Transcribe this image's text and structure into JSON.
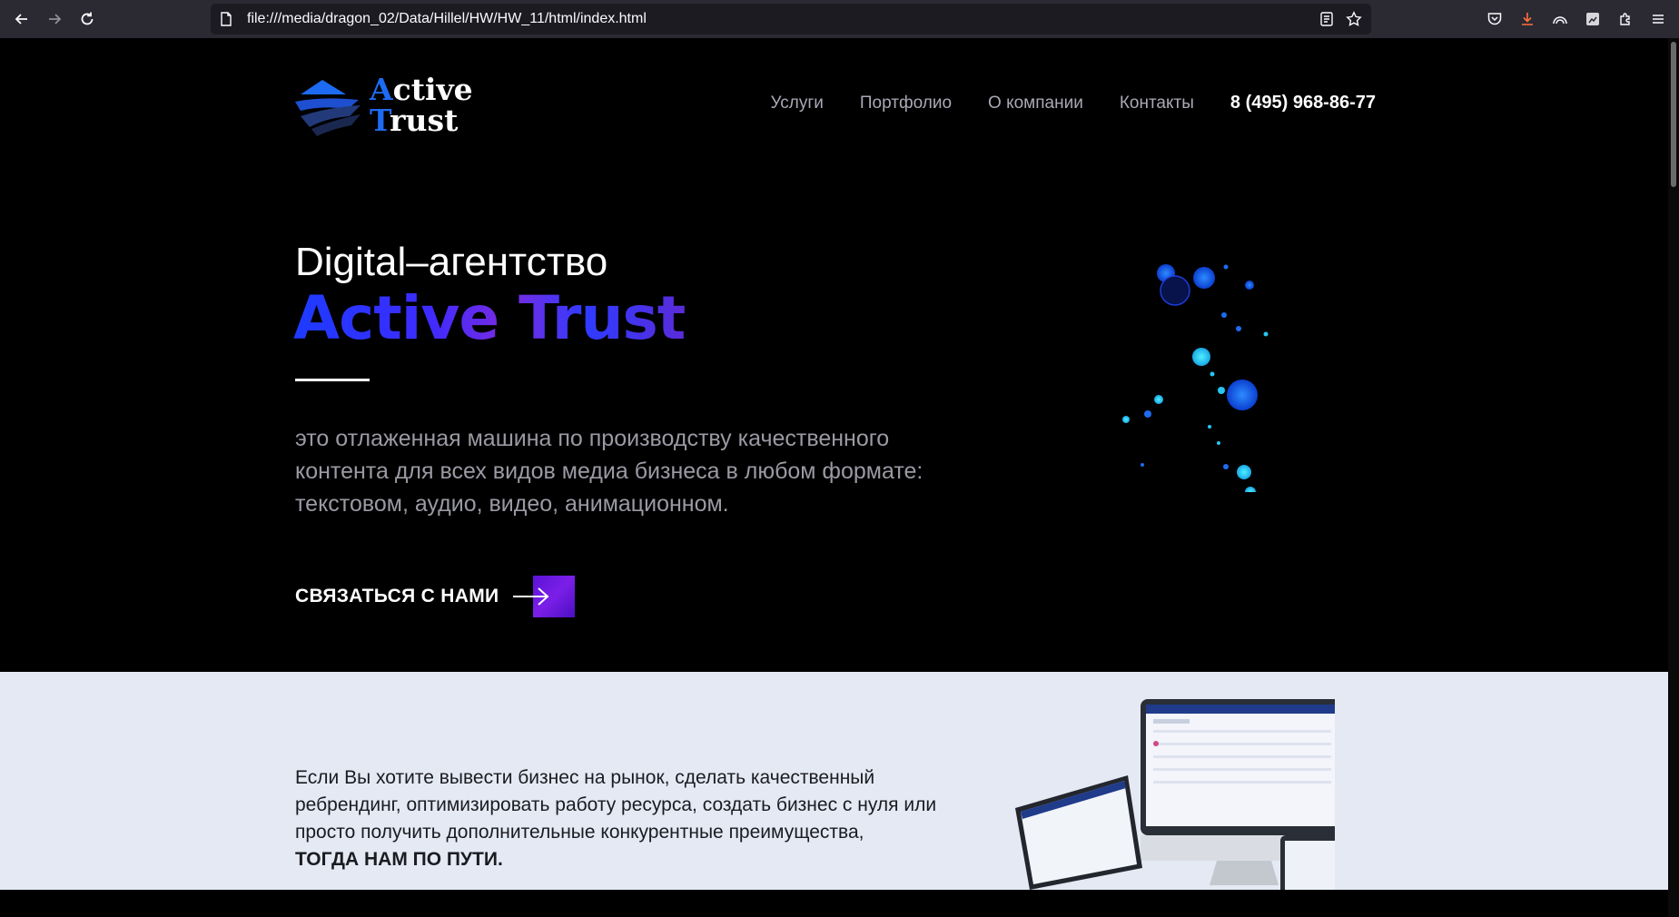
{
  "browser": {
    "url": "file:///media/dragon_02/Data/Hillel/HW/HW_11/html/index.html"
  },
  "header": {
    "logo_line1_cap": "A",
    "logo_line1_rest": "ctive",
    "logo_line2_cap": "T",
    "logo_line2_rest": "rust",
    "nav": [
      {
        "label": "Услуги"
      },
      {
        "label": "Портфолио"
      },
      {
        "label": "О компании"
      },
      {
        "label": "Контакты"
      }
    ],
    "phone": "8 (495) 968-86-77"
  },
  "hero": {
    "subtitle": "Digital–агентство",
    "title": "Active Trust",
    "description": "это отлаженная машина по производству качественного контента для всех видов медиа бизнеса в любом формате: текстовом, аудио, видео, анимационном.",
    "cta_label": "СВЯЗАТЬСЯ С НАМИ"
  },
  "section_two": {
    "text": "Если Вы хотите вывести бизнес на рынок, сделать качественный ребрендинг, оптимизировать работу ресурса, создать бизнес с нуля или просто получить дополнительные конкурентные преимущества,",
    "emphasis": "ТОГДА НАМ ПО ПУТИ."
  },
  "colors": {
    "accent_blue": "#1d6bf2",
    "cta_purple": "#6a18e0",
    "section_bg": "#e4e9f3"
  }
}
